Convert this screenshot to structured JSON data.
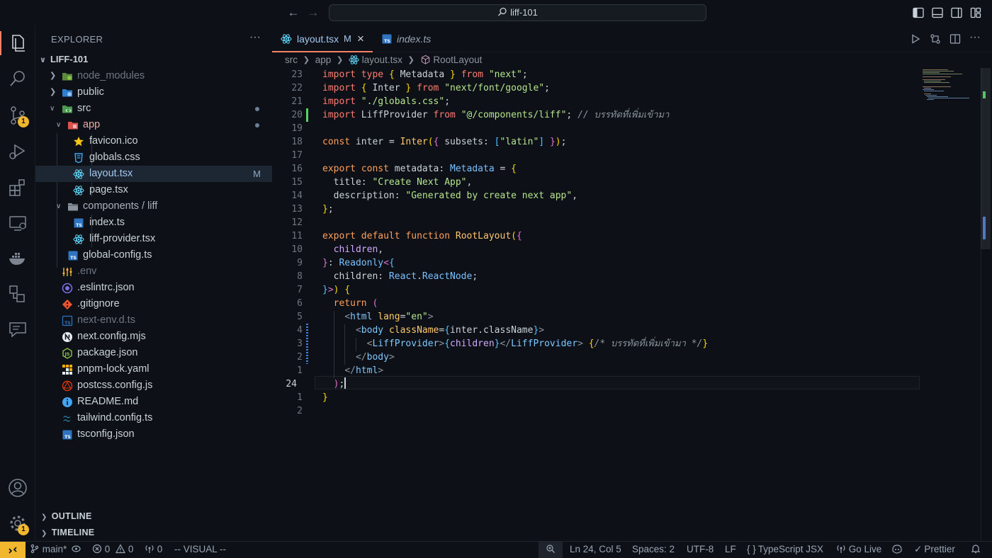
{
  "titlebar": {
    "search_text": "liff-101"
  },
  "activity_bar": {
    "source_control_badge": "1",
    "manage_badge": "1"
  },
  "explorer": {
    "header": "EXPLORER",
    "more": "···",
    "root": "LIFF-101",
    "items": [
      {
        "label": "node_modules",
        "dimmed": true
      },
      {
        "label": "public"
      },
      {
        "label": "src"
      },
      {
        "label": "app"
      },
      {
        "label": "favicon.ico"
      },
      {
        "label": "globals.css"
      },
      {
        "label": "layout.tsx",
        "status": "M"
      },
      {
        "label": "page.tsx"
      },
      {
        "label": "components / liff"
      },
      {
        "label": "index.ts"
      },
      {
        "label": "liff-provider.tsx"
      },
      {
        "label": "global-config.ts"
      },
      {
        "label": ".env",
        "dimmed": true
      },
      {
        "label": ".eslintrc.json"
      },
      {
        "label": ".gitignore"
      },
      {
        "label": "next-env.d.ts",
        "dimmed": true
      },
      {
        "label": "next.config.mjs"
      },
      {
        "label": "package.json"
      },
      {
        "label": "pnpm-lock.yaml"
      },
      {
        "label": "postcss.config.js"
      },
      {
        "label": "README.md"
      },
      {
        "label": "tailwind.config.ts"
      },
      {
        "label": "tsconfig.json"
      }
    ],
    "outline": "OUTLINE",
    "timeline": "TIMELINE"
  },
  "tabs": [
    {
      "label": "layout.tsx",
      "status": "M",
      "close": "×"
    },
    {
      "label": "index.ts"
    }
  ],
  "breadcrumb": [
    "src",
    "app",
    "layout.tsx",
    "RootLayout"
  ],
  "editor": {
    "line_numbers": [
      "23",
      "22",
      "21",
      "20",
      "19",
      "18",
      "17",
      "16",
      "15",
      "14",
      "13",
      "12",
      "11",
      "10",
      "9",
      "8",
      "7",
      "6",
      "5",
      "4",
      "3",
      "2",
      "1",
      "24",
      "1",
      "2"
    ]
  },
  "status_bar": {
    "branch": "main*",
    "errors": "0",
    "warnings": "0",
    "ports": "0",
    "mode": "-- VISUAL --",
    "position": "Ln 24, Col 5",
    "spaces": "Spaces: 2",
    "encoding": "UTF-8",
    "eol": "LF",
    "language": "TypeScript JSX",
    "language_icon": "{ }",
    "live": "Go Live",
    "prettier": "Prettier"
  },
  "colors": {
    "accent": "#f78166",
    "badge": "#f0b72f",
    "git_added": "#56d364",
    "git_modified": "#4a7bd1"
  }
}
